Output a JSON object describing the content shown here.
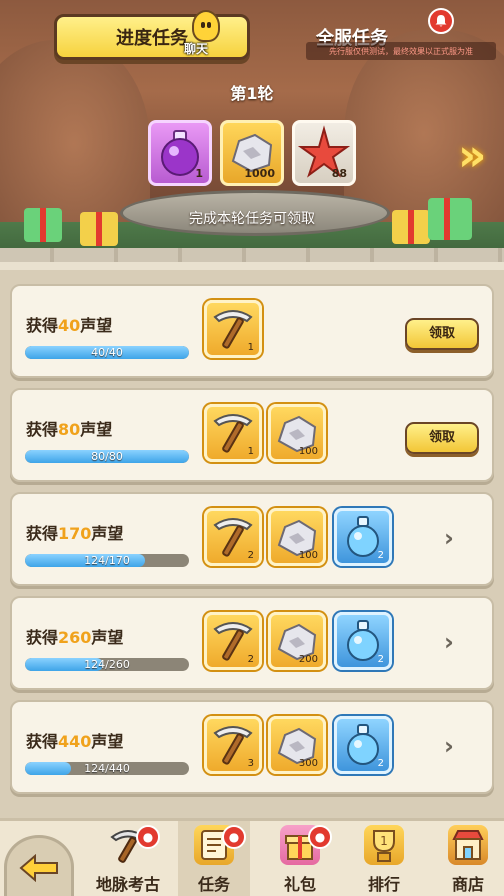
{
  "header": {
    "tab_progress": "进度任务",
    "chat_label": "聊天",
    "tab_server": "全服任务",
    "test_note": "先行服仅供测试，最终效果以正式服为准"
  },
  "round": {
    "title": "第1轮",
    "hint": "完成本轮任务可领取",
    "rewards": [
      {
        "icon": "purple-potion-icon",
        "count": "1"
      },
      {
        "icon": "stone-ore-icon",
        "count": "1000"
      },
      {
        "icon": "red-starfish-icon",
        "count": "88"
      }
    ]
  },
  "tasks": [
    {
      "prefix": "获得",
      "amount": "40",
      "suffix": "声望",
      "progress_text": "40/40",
      "progress": 1.0,
      "items": [
        {
          "type": "pickaxe",
          "count": "1"
        }
      ],
      "action": "领取"
    },
    {
      "prefix": "获得",
      "amount": "80",
      "suffix": "声望",
      "progress_text": "80/80",
      "progress": 1.0,
      "items": [
        {
          "type": "pickaxe",
          "count": "1"
        },
        {
          "type": "stone",
          "count": "100"
        }
      ],
      "action": "领取"
    },
    {
      "prefix": "获得",
      "amount": "170",
      "suffix": "声望",
      "progress_text": "124/170",
      "progress": 0.729,
      "items": [
        {
          "type": "pickaxe",
          "count": "2"
        },
        {
          "type": "stone",
          "count": "100"
        },
        {
          "type": "bottle",
          "count": "2"
        }
      ],
      "action": ""
    },
    {
      "prefix": "获得",
      "amount": "260",
      "suffix": "声望",
      "progress_text": "124/260",
      "progress": 0.477,
      "items": [
        {
          "type": "pickaxe",
          "count": "2"
        },
        {
          "type": "stone",
          "count": "200"
        },
        {
          "type": "bottle",
          "count": "2"
        }
      ],
      "action": ""
    },
    {
      "prefix": "获得",
      "amount": "440",
      "suffix": "声望",
      "progress_text": "124/440",
      "progress": 0.282,
      "items": [
        {
          "type": "pickaxe",
          "count": "3"
        },
        {
          "type": "stone",
          "count": "300"
        },
        {
          "type": "bottle",
          "count": "2"
        }
      ],
      "action": ""
    }
  ],
  "nav": {
    "items": [
      {
        "label": "地脉考古",
        "icon": "pickaxe-icon",
        "badge": true
      },
      {
        "label": "任务",
        "icon": "task-scroll-icon",
        "badge": true,
        "active": true
      },
      {
        "label": "礼包",
        "icon": "gift-box-icon",
        "badge": true
      },
      {
        "label": "排行",
        "icon": "rank-trophy-icon",
        "badge": false
      },
      {
        "label": "商店",
        "icon": "shop-icon",
        "badge": false
      }
    ]
  },
  "colors": {
    "accent_orange": "#f0a21c",
    "progress_blue": "#3ea4e8",
    "badge_red": "#e23a2f",
    "button_yellow": "#f2c636"
  }
}
